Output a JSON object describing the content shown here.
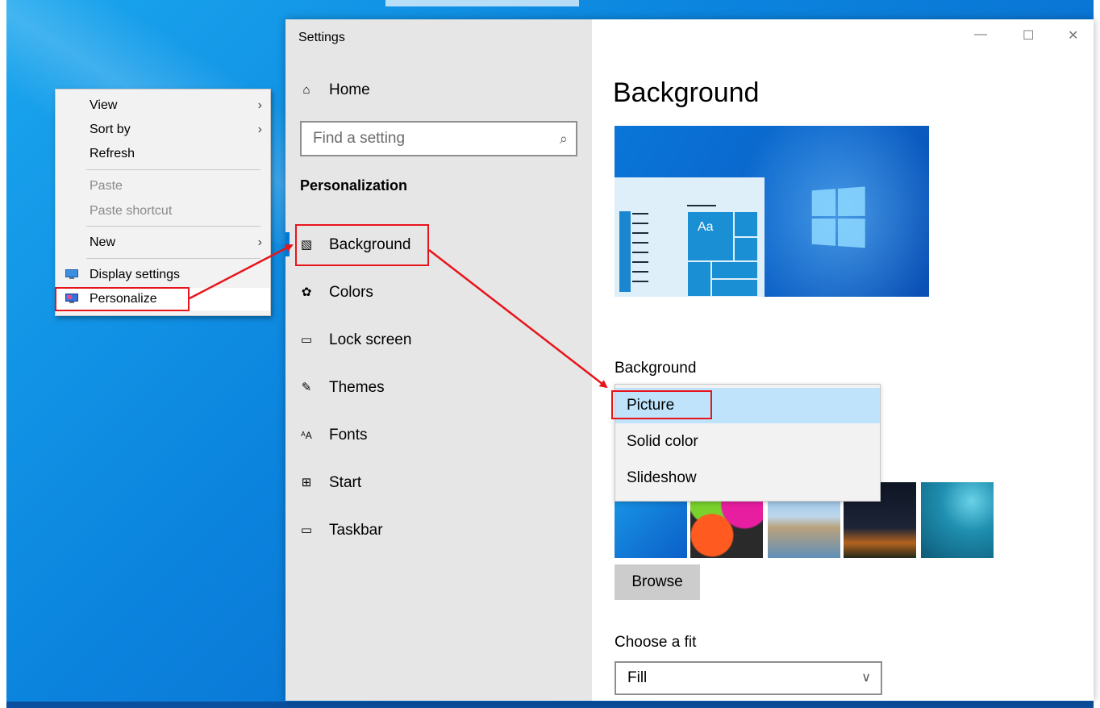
{
  "context_menu": {
    "items": [
      {
        "label": "View",
        "submenu": true,
        "disabled": false
      },
      {
        "label": "Sort by",
        "submenu": true,
        "disabled": false
      },
      {
        "label": "Refresh",
        "submenu": false,
        "disabled": false
      },
      {
        "label": "Paste",
        "submenu": false,
        "disabled": true
      },
      {
        "label": "Paste shortcut",
        "submenu": false,
        "disabled": true
      },
      {
        "label": "New",
        "submenu": true,
        "disabled": false
      },
      {
        "label": "Display settings",
        "submenu": false,
        "disabled": false,
        "icon": "display-icon"
      },
      {
        "label": "Personalize",
        "submenu": false,
        "disabled": false,
        "icon": "personalize-icon"
      }
    ]
  },
  "settings": {
    "app_title": "Settings",
    "home_label": "Home",
    "search_placeholder": "Find a setting",
    "section_heading": "Personalization",
    "nav_items": [
      {
        "label": "Background",
        "icon": "picture-icon"
      },
      {
        "label": "Colors",
        "icon": "palette-icon"
      },
      {
        "label": "Lock screen",
        "icon": "lock-screen-icon"
      },
      {
        "label": "Themes",
        "icon": "themes-icon"
      },
      {
        "label": "Fonts",
        "icon": "fonts-icon"
      },
      {
        "label": "Start",
        "icon": "start-icon"
      },
      {
        "label": "Taskbar",
        "icon": "taskbar-icon"
      }
    ],
    "page_title": "Background",
    "preview_tile_text": "Aa",
    "background_label": "Background",
    "background_options": [
      "Picture",
      "Solid color",
      "Slideshow"
    ],
    "background_selected": "Picture",
    "browse_label": "Browse",
    "fit_label": "Choose a fit",
    "fit_value": "Fill"
  },
  "colors": {
    "accent": "#0078d4",
    "annotation": "#e8141b",
    "dropdown_selected": "#bfe3fb"
  }
}
